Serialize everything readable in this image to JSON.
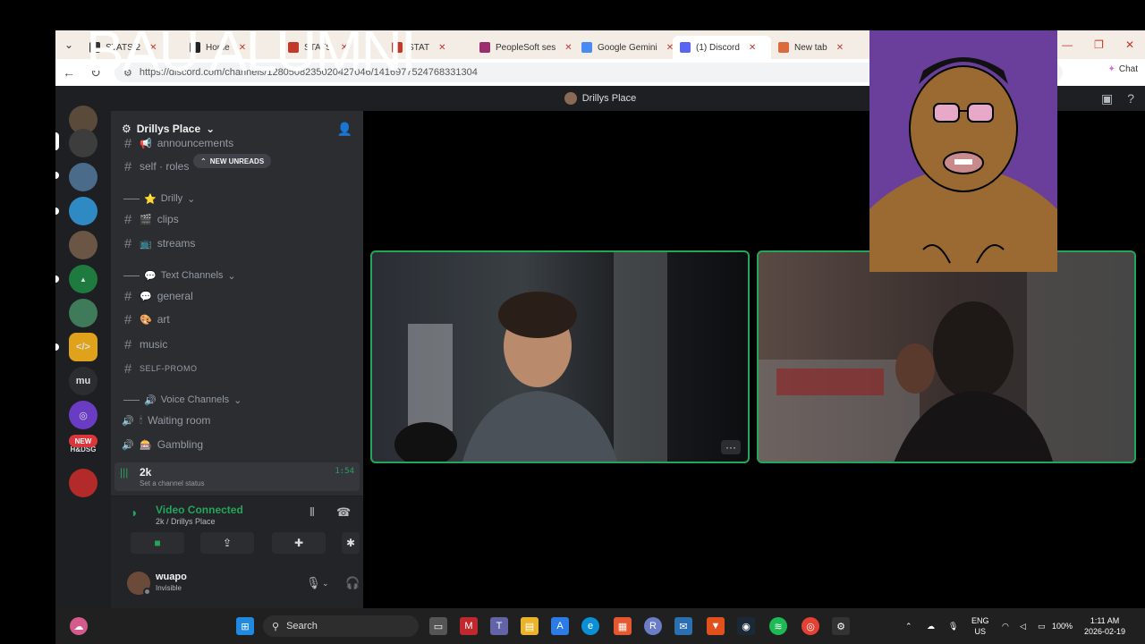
{
  "overlay": {
    "title": "BAU ALUMNI"
  },
  "browser": {
    "tabs": [
      {
        "label": "STATS 2",
        "fav": "#333"
      },
      {
        "label": "Home",
        "fav": "#222"
      },
      {
        "label": "STATS",
        "fav": "#c0392b"
      },
      {
        "label": "STAT",
        "fav": "#c0392b"
      },
      {
        "label": "PeopleSoft ses",
        "fav": "#9b2d6f"
      },
      {
        "label": "Google Gemini",
        "fav": "#4a8af4"
      },
      {
        "label": "(1) Discord",
        "fav": "#5865f2"
      },
      {
        "label": "New tab",
        "fav": "#d96b3c"
      }
    ],
    "url": "https://discord.com/channels/1280508235020427046/1416977524768331304",
    "chat_label": "Chat"
  },
  "discord": {
    "window_title": "Drillys Place",
    "guild_name": "Drillys Place",
    "new_unreads": "NEW UNREADS",
    "channels_top": [
      {
        "name": "announcements",
        "emoji": "📢"
      },
      {
        "name": "self · roles",
        "emoji": ""
      }
    ],
    "cat_drilly": "Drilly",
    "drilly_channels": [
      {
        "name": "clips",
        "emoji": "🎬"
      },
      {
        "name": "streams",
        "emoji": "📺"
      }
    ],
    "cat_text": "Text Channels",
    "text_channels": [
      {
        "name": "general",
        "emoji": "💬"
      },
      {
        "name": "art",
        "emoji": "🎨"
      },
      {
        "name": "music",
        "emoji": "🎶"
      },
      {
        "name": "SELF-PROMO",
        "emoji": ""
      }
    ],
    "cat_voice": "Voice Channels",
    "voice_channels": [
      {
        "name": "Waiting room",
        "emoji": "🕯"
      },
      {
        "name": "Gambling",
        "emoji": "🎰"
      }
    ],
    "active_voice": {
      "name": "2k",
      "status": "Set a channel status",
      "timer": "1:54"
    },
    "voice_panel": {
      "title": "Video Connected",
      "subtitle": "2k / Drillys Place"
    },
    "user": {
      "name": "wuapo",
      "status": "Invisible"
    },
    "rail_new": "NEW",
    "rail_mu": "mu",
    "rail_hd": "H&DSG"
  },
  "taskbar": {
    "search": "Search",
    "lang_top": "ENG",
    "lang_bottom": "US",
    "battery": "100%",
    "time": "1:11 AM",
    "date": "2026-02-19"
  }
}
